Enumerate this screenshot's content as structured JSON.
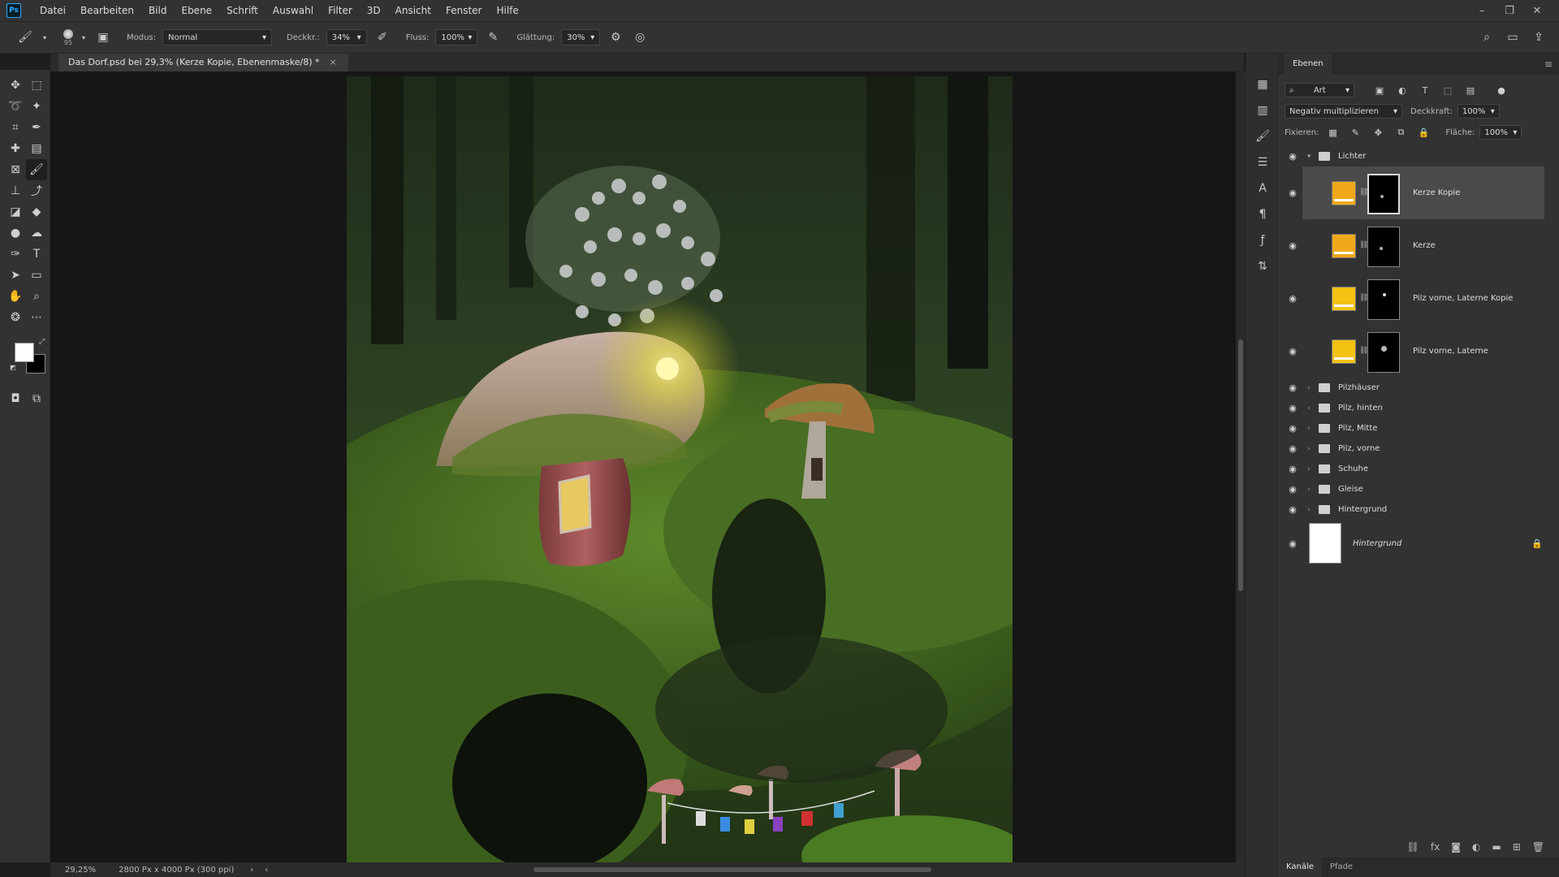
{
  "app": {
    "logo": "Ps"
  },
  "menu": [
    "Datei",
    "Bearbeiten",
    "Bild",
    "Ebene",
    "Schrift",
    "Auswahl",
    "Filter",
    "3D",
    "Ansicht",
    "Fenster",
    "Hilfe"
  ],
  "options": {
    "brush_size": "95",
    "modus_label": "Modus:",
    "modus_value": "Normal",
    "deckkraft_label": "Deckkr.:",
    "deckkraft_value": "34%",
    "fluss_label": "Fluss:",
    "fluss_value": "100%",
    "glaettung_label": "Glättung:",
    "glaettung_value": "30%"
  },
  "document": {
    "tab_title": "Das Dorf.psd bei 29,3% (Kerze Kopie, Ebenenmaske/8) *",
    "close": "×"
  },
  "status": {
    "zoom": "29,25%",
    "doc_info": "2800 Px x 4000 Px (300 ppi)"
  },
  "layers_panel": {
    "tab": "Ebenen",
    "filter_kind": "Art",
    "blend_mode": "Negativ multiplizieren",
    "opacity_label": "Deckkraft:",
    "opacity_value": "100%",
    "lock_label": "Fixieren:",
    "fill_label": "Fläche:",
    "fill_value": "100%",
    "group_open": "Lichter",
    "adjustment_layers": [
      {
        "name": "Kerze Kopie",
        "color": "#f0a81a",
        "selected": true
      },
      {
        "name": "Kerze",
        "color": "#f0a81a",
        "selected": false
      },
      {
        "name": "Pilz vorne, Laterne Kopie",
        "color": "#f3c213",
        "selected": false
      },
      {
        "name": "Pilz vorne, Laterne",
        "color": "#f3c213",
        "selected": false
      }
    ],
    "groups": [
      "Pilzhäuser",
      "Pilz, hinten",
      "Pilz, Mitte",
      "Pilz, vorne",
      "Schuhe",
      "Gleise",
      "Hintergrund"
    ],
    "background_layer": "Hintergrund",
    "bottom_tabs": [
      "Kanäle",
      "Pfade"
    ]
  }
}
